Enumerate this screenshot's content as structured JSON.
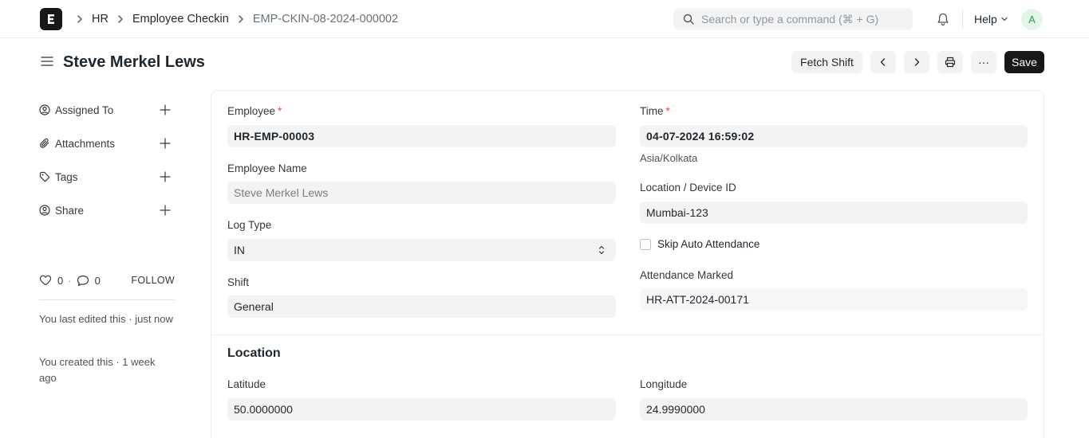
{
  "navbar": {
    "breadcrumbs": [
      "HR",
      "Employee Checkin",
      "EMP-CKIN-08-2024-000002"
    ],
    "search_placeholder": "Search or type a command (⌘ + G)",
    "help_label": "Help",
    "avatar_initial": "A",
    "logo_letter": "E"
  },
  "page": {
    "title": "Steve Merkel Lews",
    "buttons": {
      "fetch_shift": "Fetch Shift",
      "more": "···",
      "save": "Save"
    }
  },
  "sidebar": {
    "items": [
      {
        "label": "Assigned To",
        "icon": "assign-user-icon"
      },
      {
        "label": "Attachments",
        "icon": "paperclip-icon"
      },
      {
        "label": "Tags",
        "icon": "tag-icon"
      },
      {
        "label": "Share",
        "icon": "share-user-icon"
      }
    ],
    "likes": "0",
    "comments": "0",
    "stats_separator": "·",
    "follow_label": "FOLLOW",
    "last_edited": "You last edited this · just now",
    "created": "You created this · 1 week ago"
  },
  "form": {
    "employee": {
      "label": "Employee",
      "value": "HR-EMP-00003",
      "required": "*"
    },
    "employee_name": {
      "label": "Employee Name",
      "value": "Steve Merkel Lews"
    },
    "log_type": {
      "label": "Log Type",
      "value": "IN"
    },
    "shift": {
      "label": "Shift",
      "value": "General"
    },
    "time": {
      "label": "Time",
      "value": "04-07-2024 16:59:02",
      "required": "*",
      "timezone": "Asia/Kolkata"
    },
    "location_device": {
      "label": "Location / Device ID",
      "value": "Mumbai-123"
    },
    "skip_auto_attendance": {
      "label": "Skip Auto Attendance",
      "checked": false
    },
    "attendance_marked": {
      "label": "Attendance Marked",
      "value": "HR-ATT-2024-00171"
    },
    "location_section": {
      "title": "Location",
      "latitude": {
        "label": "Latitude",
        "value": "50.0000000"
      },
      "longitude": {
        "label": "Longitude",
        "value": "24.9990000"
      }
    }
  },
  "colors": {
    "primary_button": "#171717",
    "field_bg": "#f3f3f3",
    "required": "#e24c4c",
    "avatar_bg": "#e4f5e9",
    "avatar_fg": "#2e9c4c"
  }
}
